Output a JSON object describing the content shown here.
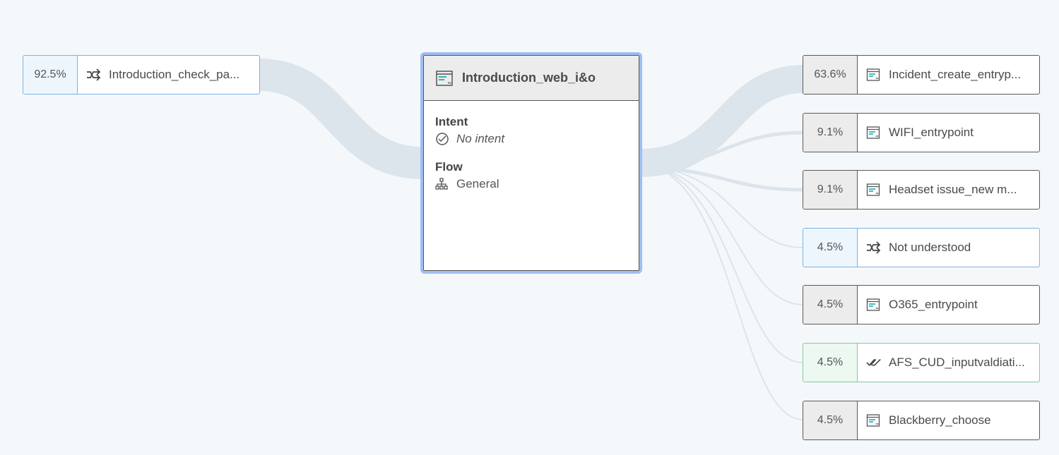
{
  "center": {
    "title": "Introduction_web_i&o",
    "intent_label": "Intent",
    "intent_value": "No intent",
    "flow_label": "Flow",
    "flow_value": "General"
  },
  "incoming": [
    {
      "pct": "92.5%",
      "label": "Introduction_check_pa...",
      "icon": "redirect-icon",
      "style": "blue"
    }
  ],
  "outgoing": [
    {
      "pct": "63.6%",
      "label": "Incident_create_entryp...",
      "icon": "page-icon",
      "style": "plain"
    },
    {
      "pct": "9.1%",
      "label": "WIFI_entrypoint",
      "icon": "page-icon",
      "style": "plain"
    },
    {
      "pct": "9.1%",
      "label": "Headset issue_new m...",
      "icon": "page-icon",
      "style": "plain"
    },
    {
      "pct": "4.5%",
      "label": "Not understood",
      "icon": "redirect-icon",
      "style": "blue"
    },
    {
      "pct": "4.5%",
      "label": "O365_entrypoint",
      "icon": "page-icon",
      "style": "plain"
    },
    {
      "pct": "4.5%",
      "label": "AFS_CUD_inputvaldiati...",
      "icon": "double-check-icon",
      "style": "green"
    },
    {
      "pct": "4.5%",
      "label": "Blackberry_choose",
      "icon": "page-icon",
      "style": "plain"
    }
  ],
  "colors": {
    "link": "#dce4ec",
    "page_icon_accent": "#2bb3c0",
    "selected_border": "#9fbdf3"
  }
}
